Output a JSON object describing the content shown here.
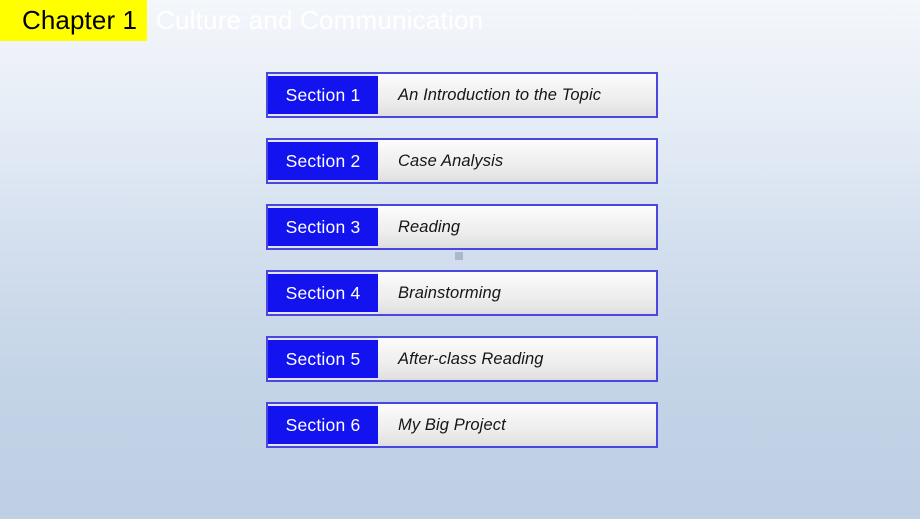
{
  "title_bar": {
    "chapter_label": "Chapter 1",
    "chapter_title": "Culture and Communication",
    "highlight_color": "#ffff00",
    "label_text_color": "#000000",
    "title_text_color": "#ffffff"
  },
  "colors": {
    "accent_blue": "#1313ef",
    "border_blue": "#4a46e0",
    "background_top": "#f4f7fb",
    "background_bottom": "#bfd0e4",
    "row_fill_top": "#fdfdfd",
    "row_fill_bottom": "#dedede"
  },
  "sections": [
    {
      "tag": "Section 1",
      "title": "An Introduction to the Topic"
    },
    {
      "tag": "Section 2",
      "title": "Case Analysis"
    },
    {
      "tag": "Section 3",
      "title": "Reading"
    },
    {
      "tag": "Section 4",
      "title": "Brainstorming"
    },
    {
      "tag": "Section 5",
      "title": "After-class Reading"
    },
    {
      "tag": "Section 6",
      "title": "My Big Project"
    }
  ]
}
